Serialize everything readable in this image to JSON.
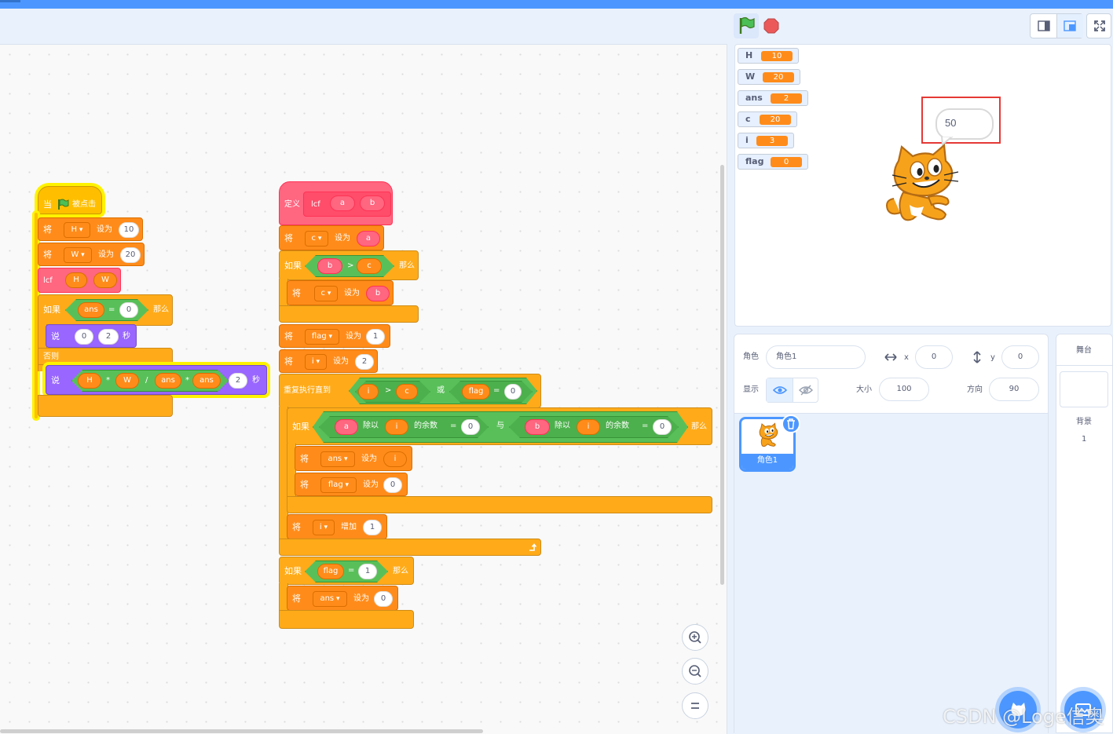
{
  "code": {
    "script1": {
      "hat": {
        "when": "当",
        "clicked": "被点击"
      },
      "set": "将",
      "to": "设为",
      "set_h": {
        "var": "H",
        "value": "10"
      },
      "set_w": {
        "var": "W",
        "value": "20"
      },
      "call": {
        "name": "lcf",
        "arg1": "H",
        "arg2": "W"
      },
      "if": {
        "kw": "如果",
        "then": "那么",
        "left": "ans",
        "op": "=",
        "right": "0"
      },
      "say1": {
        "kw": "说",
        "text": "0",
        "secs": "2",
        "unit": "秒"
      },
      "else": "否则",
      "say2": {
        "kw": "说",
        "h": "H",
        "mul1": "*",
        "w": "W",
        "div": "/",
        "ans1": "ans",
        "mul2": "*",
        "ans2": "ans",
        "secs": "2",
        "unit": "秒"
      }
    },
    "script2": {
      "define": {
        "kw": "定义",
        "name": "lcf",
        "a": "a",
        "b": "b"
      },
      "set": "将",
      "to": "设为",
      "if_kw": "如果",
      "then": "那么",
      "and": "与",
      "or": "或",
      "set_c_a": {
        "var": "c",
        "value": "a"
      },
      "if_bc": {
        "left": "b",
        "op": ">",
        "right": "c"
      },
      "set_c_b": {
        "var": "c",
        "value": "b"
      },
      "set_flag1": {
        "var": "flag",
        "value": "1"
      },
      "set_i2": {
        "var": "i",
        "value": "2"
      },
      "repeat": {
        "kw": "重复执行直到",
        "i": "i",
        "gt": ">",
        "c": "c",
        "flag": "flag",
        "eq": "=",
        "zero": "0"
      },
      "inner_if": {
        "a": "a",
        "mod": "除以",
        "i": "i",
        "rem": "的余数",
        "eq": "=",
        "zero": "0",
        "b": "b"
      },
      "set_ans_i": {
        "var": "ans",
        "value": "i"
      },
      "set_flag0": {
        "var": "flag",
        "value": "0"
      },
      "change_i": {
        "var": "i",
        "kw": "增加",
        "value": "1"
      },
      "if_flag": {
        "left": "flag",
        "op": "=",
        "right": "1"
      },
      "set_ans0": {
        "var": "ans",
        "value": "0"
      }
    }
  },
  "stage": {
    "monitors": [
      {
        "name": "H",
        "value": "10"
      },
      {
        "name": "W",
        "value": "20"
      },
      {
        "name": "ans",
        "value": "2"
      },
      {
        "name": "c",
        "value": "20"
      },
      {
        "name": "i",
        "value": "3"
      },
      {
        "name": "flag",
        "value": "0"
      }
    ],
    "speech": "50"
  },
  "sprite_info": {
    "sprite_label": "角色",
    "sprite_name": "角色1",
    "x_label": "x",
    "x": "0",
    "y_label": "y",
    "y": "0",
    "show_label": "显示",
    "size_label": "大小",
    "size": "100",
    "direction_label": "方向",
    "direction": "90"
  },
  "sprite_tile": {
    "name": "角色1"
  },
  "stage_panel": {
    "title": "舞台",
    "backdrops_label": "背景",
    "backdrops_count": "1"
  },
  "watermark": "CSDN @Loge信奥",
  "colors": {
    "events": "#ffbf00",
    "variables": "#ff8c1a",
    "control": "#ffab19",
    "looks": "#9966ff",
    "operators": "#59c059",
    "my_blocks": "#ff6680",
    "accent": "#4c97ff"
  }
}
